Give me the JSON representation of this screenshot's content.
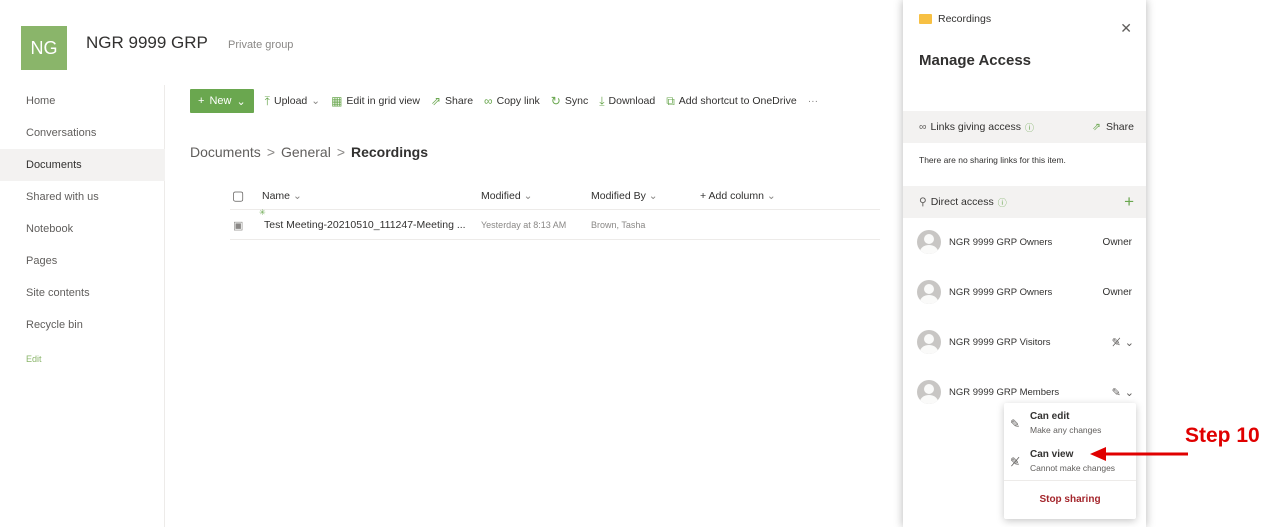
{
  "header": {
    "logo_text": "NG",
    "site_title": "NGR 9999 GRP",
    "privacy": "Private group"
  },
  "left_nav": {
    "items": [
      {
        "label": "Home"
      },
      {
        "label": "Conversations"
      },
      {
        "label": "Documents",
        "active": true
      },
      {
        "label": "Shared with us"
      },
      {
        "label": "Notebook"
      },
      {
        "label": "Pages"
      },
      {
        "label": "Site contents"
      },
      {
        "label": "Recycle bin"
      }
    ],
    "edit": "Edit"
  },
  "command_bar": {
    "new": "New",
    "upload": "Upload",
    "edit_grid": "Edit in grid view",
    "share": "Share",
    "copy_link": "Copy link",
    "sync": "Sync",
    "download": "Download",
    "add_shortcut": "Add shortcut to OneDrive",
    "more": "···"
  },
  "breadcrumb": {
    "items": [
      "Documents",
      "General"
    ],
    "current": "Recordings",
    "separator": ">"
  },
  "file_list": {
    "columns": {
      "name": "Name",
      "modified": "Modified",
      "modified_by": "Modified By",
      "add_column": "+ Add column"
    },
    "rows": [
      {
        "name": "Test Meeting-20210510_111247-Meeting ...",
        "modified": "Yesterday at 8:13 AM",
        "modified_by": "Brown, Tasha"
      }
    ]
  },
  "panel": {
    "folder": "Recordings",
    "title": "Manage Access",
    "links_section": "Links giving access",
    "share": "Share",
    "no_links": "There are no sharing links for this item.",
    "direct_access": "Direct access",
    "members": [
      {
        "name": "NGR 9999 GRP Owners",
        "role": "Owner"
      },
      {
        "name": "NGR 9999 GRP Owners",
        "role": "Owner"
      },
      {
        "name": "NGR 9999 GRP Visitors",
        "role": ""
      },
      {
        "name": "NGR 9999 GRP Members",
        "role": ""
      }
    ]
  },
  "permission_menu": {
    "can_edit_title": "Can edit",
    "can_edit_desc": "Make any changes",
    "can_view_title": "Can view",
    "can_view_desc": "Cannot make changes",
    "stop_sharing": "Stop sharing"
  },
  "annotation": {
    "step_label": "Step 10",
    "color": "#e00000"
  },
  "colors": {
    "accent": "#6aa74f",
    "logo": "#8ab56a",
    "stop": "#a4262c"
  }
}
